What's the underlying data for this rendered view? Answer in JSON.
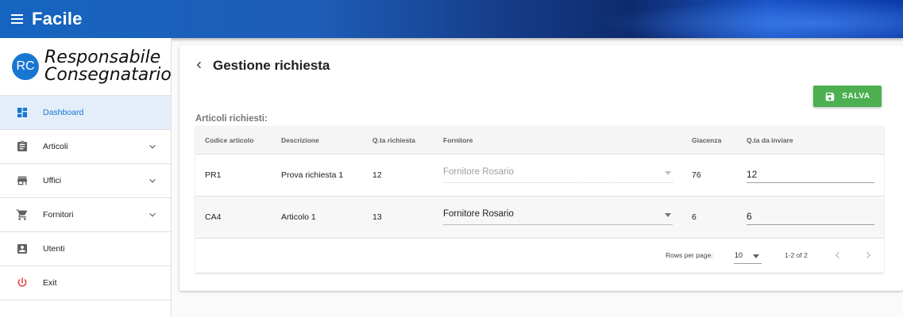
{
  "app": {
    "title": "Facile"
  },
  "sidebar": {
    "avatar_initials": "RC",
    "brand_line1": "Responsabile",
    "brand_line2": "Consegnatario",
    "items": [
      {
        "label": "Dashboard",
        "icon": "dashboard-icon",
        "active": true
      },
      {
        "label": "Articoli",
        "icon": "clipboard-icon",
        "expandable": true
      },
      {
        "label": "Uffici",
        "icon": "store-icon",
        "expandable": true
      },
      {
        "label": "Fornitori",
        "icon": "cart-icon",
        "expandable": true
      },
      {
        "label": "Utenti",
        "icon": "user-box-icon"
      },
      {
        "label": "Exit",
        "icon": "power-icon"
      }
    ]
  },
  "page": {
    "title": "Gestione richiesta",
    "save_label": "SALVA",
    "section_label": "Articoli richiesti:"
  },
  "table": {
    "headers": [
      "Codice articolo",
      "Descrizione",
      "Q.ta richiesta",
      "Fornitore",
      "Giacenza",
      "Q.ta da inviare"
    ],
    "rows": [
      {
        "codice": "PR1",
        "descrizione": "Prova richiesta 1",
        "qta_richiesta": "12",
        "fornitore": "Fornitore Rosario",
        "fornitore_disabled": true,
        "giacenza": "76",
        "qta_da_inviare": "12"
      },
      {
        "codice": "CA4",
        "descrizione": "Articolo 1",
        "qta_richiesta": "13",
        "fornitore": "Fornitore Rosario",
        "fornitore_disabled": false,
        "giacenza": "6",
        "qta_da_inviare": "6"
      }
    ]
  },
  "pagination": {
    "rows_per_page_label": "Rows per page:",
    "rows_per_page": "10",
    "range": "1-2 of 2"
  },
  "colors": {
    "primary": "#1976d2",
    "save_button": "#4caf50",
    "exit_icon": "#e53935"
  }
}
